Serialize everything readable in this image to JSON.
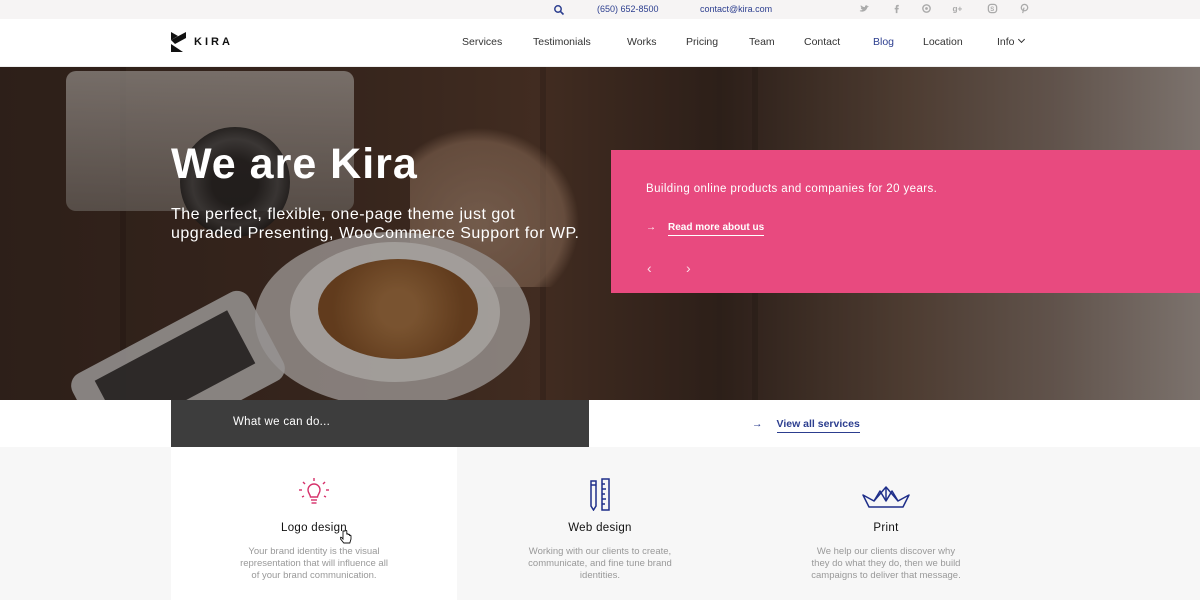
{
  "topbar": {
    "phone": "(650) 652-8500",
    "email": "contact@kira.com",
    "social_icons": [
      "twitter-icon",
      "facebook-icon",
      "github-icon",
      "google-plus-icon",
      "skype-icon",
      "pinterest-icon"
    ]
  },
  "nav": {
    "logo_text": "KIRA",
    "items": [
      {
        "label": "Services"
      },
      {
        "label": "Testimonials"
      },
      {
        "label": "Works"
      },
      {
        "label": "Pricing"
      },
      {
        "label": "Team"
      },
      {
        "label": "Contact"
      },
      {
        "label": "Blog",
        "active": true
      },
      {
        "label": "Location"
      },
      {
        "label": "Info",
        "has_dropdown": true
      }
    ]
  },
  "hero": {
    "title": "We are Kira",
    "subtitle": "The perfect, flexible, one-page theme just got upgraded Presenting, WooCommerce Support for WP.",
    "panel": {
      "text": "Building online products and companies for 20 years.",
      "link": "Read more about us"
    }
  },
  "services": {
    "heading": "What we can do...",
    "view_all": "View all services",
    "cards": [
      {
        "icon": "lightbulb-icon",
        "title": "Logo design",
        "desc": "Your brand identity is the visual representation that will influence all of your brand communication."
      },
      {
        "icon": "pencil-ruler-icon",
        "title": "Web design",
        "desc": "Working with our clients to create, communicate, and fine tune brand identities."
      },
      {
        "icon": "paper-boat-icon",
        "title": "Print",
        "desc": "We help our clients discover why they do what they do, then we build campaigns to deliver that message."
      }
    ]
  },
  "colors": {
    "accent": "#e84a7f",
    "link": "#2c3e8f",
    "dark": "#3d3d3d"
  }
}
